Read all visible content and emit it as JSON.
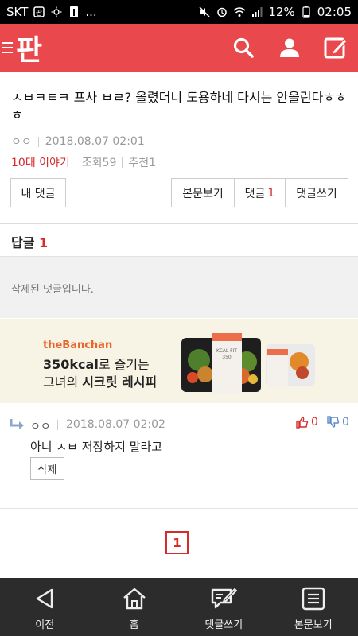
{
  "status_bar": {
    "carrier": "SKT",
    "extra": "...",
    "battery": "12%",
    "time": "02:05"
  },
  "app_bar": {
    "logo": "판"
  },
  "post": {
    "title": "ㅅㅂㅋㅌㅋ 프사 ㅂㄹ? 올렸더니 도용하네 다시는 안올린다ㅎㅎㅎ",
    "author": "ㅇㅇ",
    "date": "2018.08.07 02:01",
    "category": "10대 이야기",
    "views": "조회59",
    "recommend": "추천1"
  },
  "buttons": {
    "my_comments": "내 댓글",
    "view_post": "본문보기",
    "comments_label": "댓글",
    "comments_count": "1",
    "write_comment": "댓글쓰기"
  },
  "replies": {
    "label": "답글",
    "count": "1",
    "deleted_text": "삭제된 댓글입니다."
  },
  "ad": {
    "brand": "theBanchan",
    "line1_bold": "350kcal",
    "line1_rest": "로 즐기는",
    "line2_pre": "그녀의 ",
    "line2_bold": "시크릿 레시피",
    "pack_label": "KCAL FIT",
    "pack_kcal": "350"
  },
  "comment": {
    "author": "ㅇㅇ",
    "date": "2018.08.07 02:02",
    "up": "0",
    "down": "0",
    "text": "아니 ㅅㅂ 저장하지 말라고",
    "delete": "삭제"
  },
  "pagination": {
    "current": "1"
  },
  "bottom_nav": [
    {
      "label": "이전"
    },
    {
      "label": "홈"
    },
    {
      "label": "댓글쓰기"
    },
    {
      "label": "본문보기"
    }
  ],
  "colors": {
    "accent": "#e9484c",
    "highlight": "#d52b2b",
    "bottom_bar": "#2c2c2c"
  }
}
